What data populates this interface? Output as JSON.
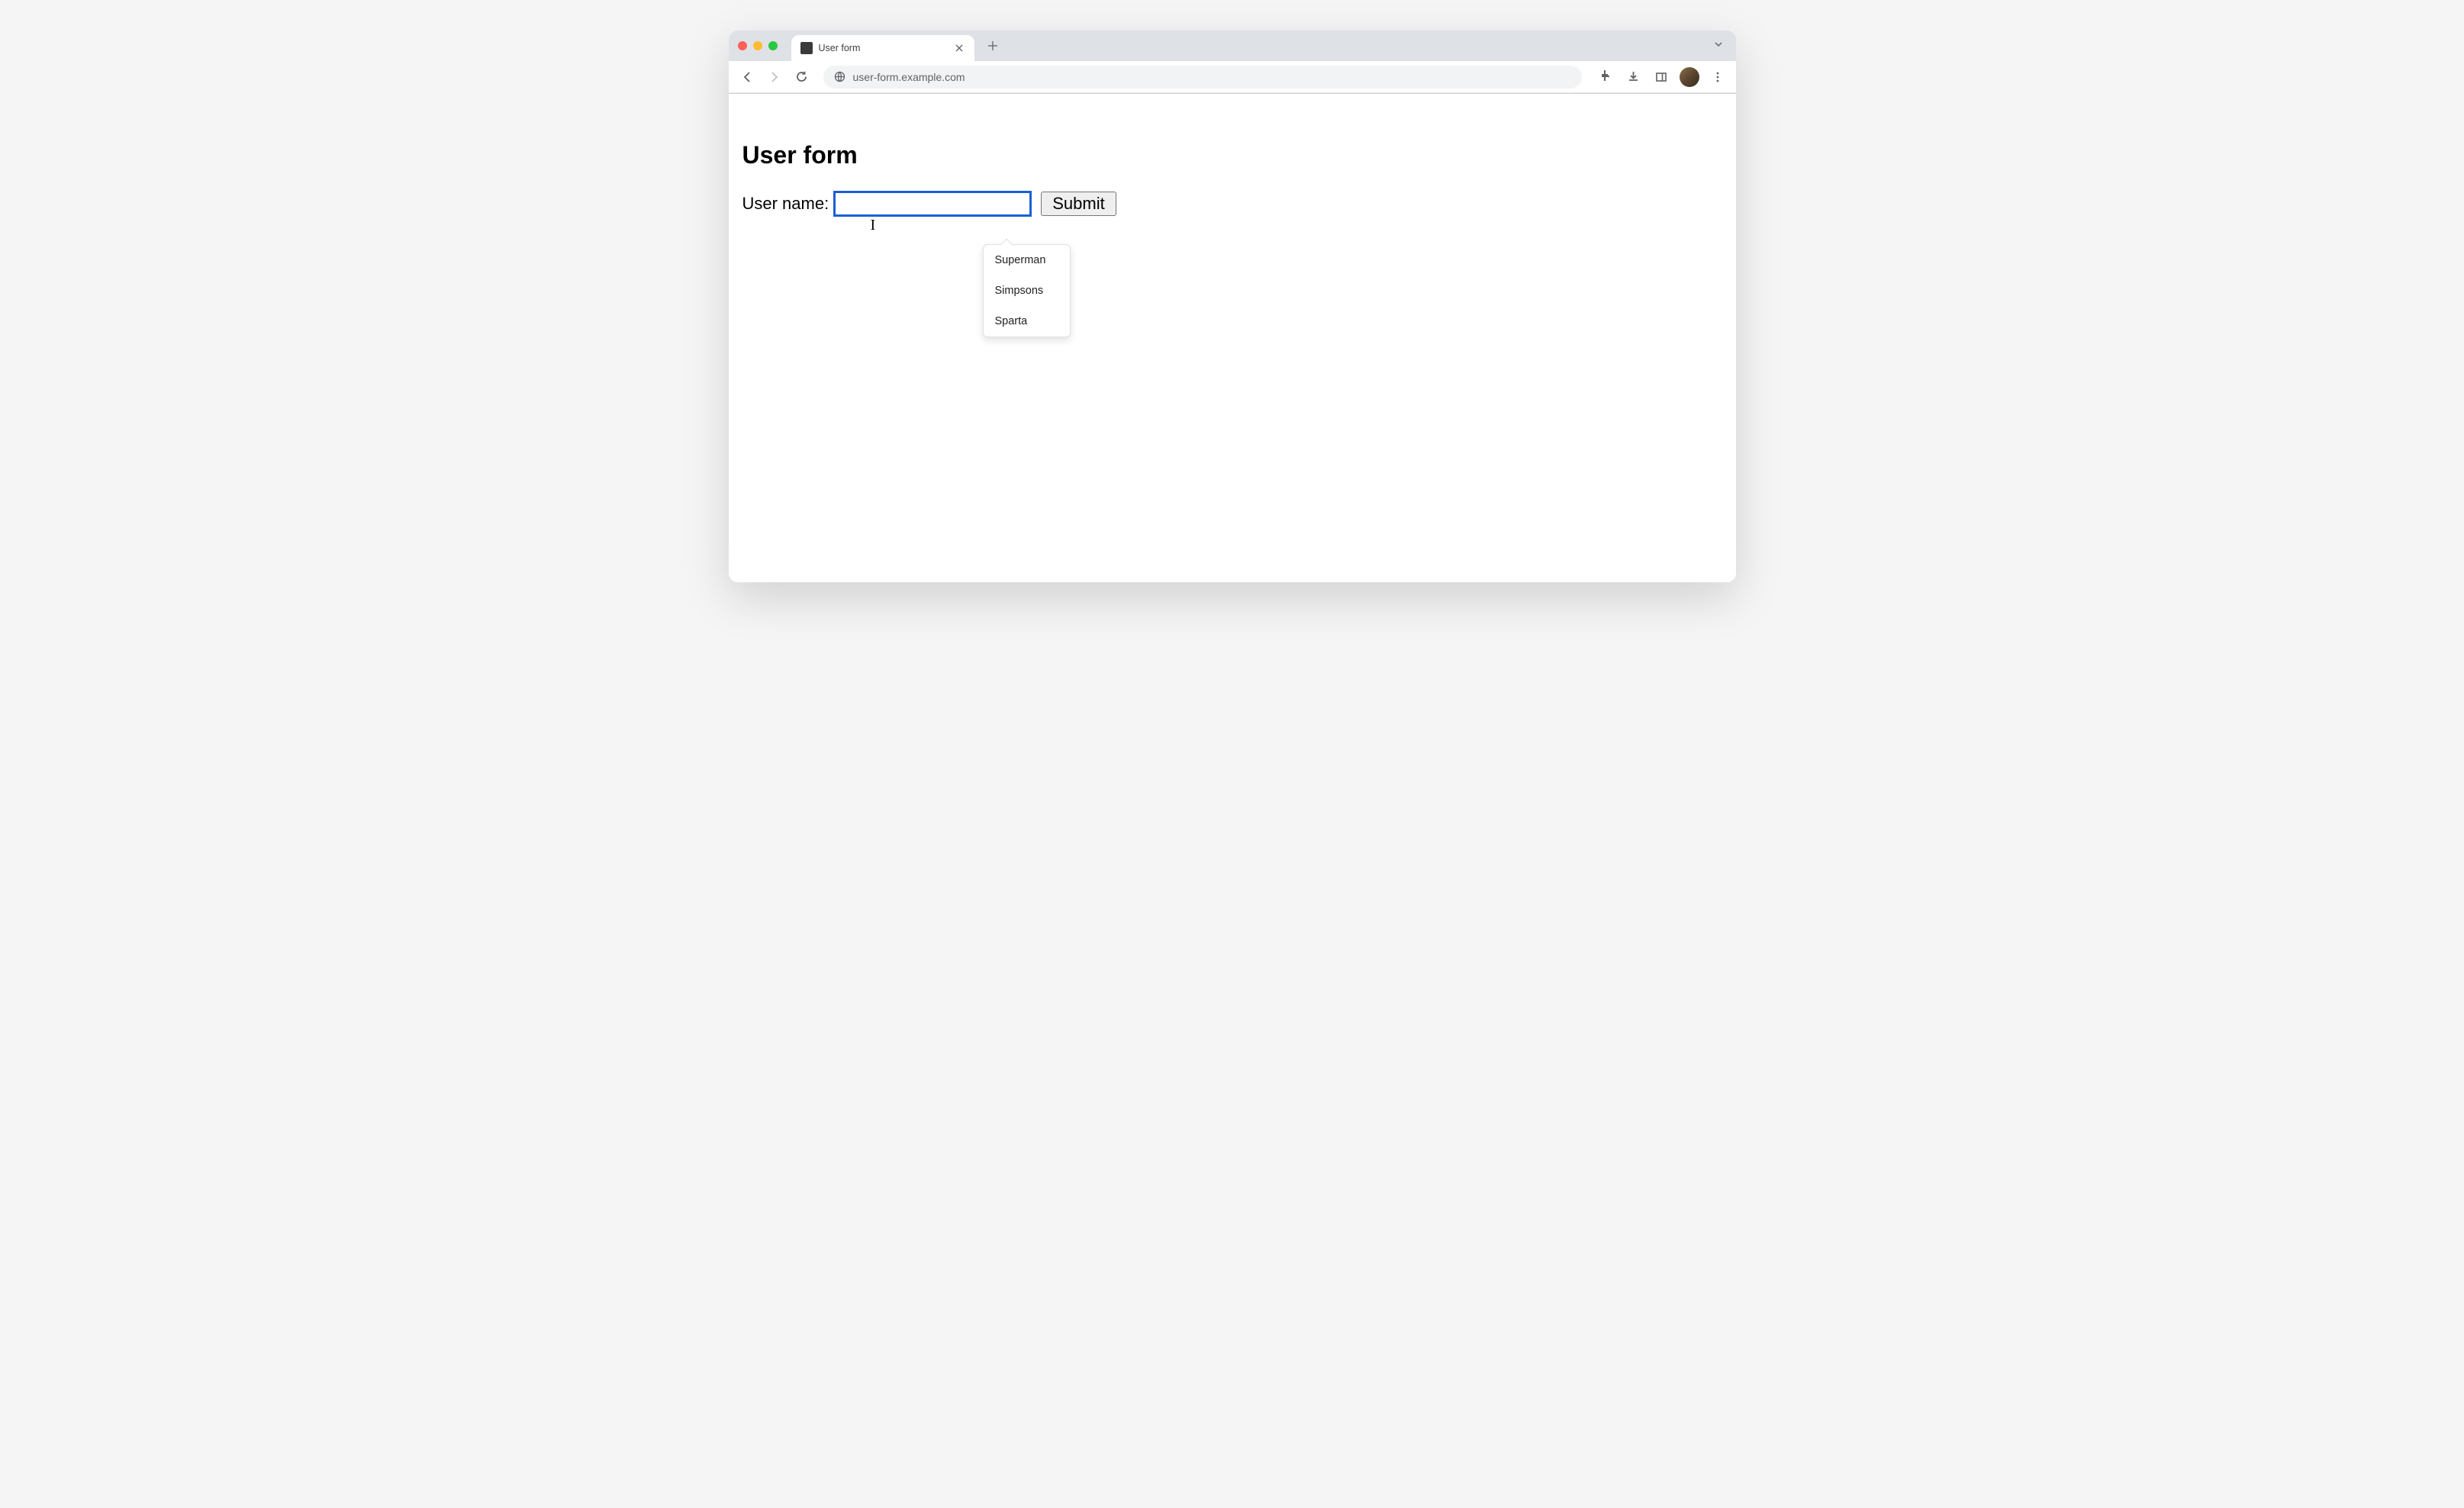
{
  "browser": {
    "tab": {
      "title": "User form"
    },
    "url": "user-form.example.com"
  },
  "page": {
    "heading": "User form",
    "form": {
      "label": "User name:",
      "input_value": "",
      "submit_label": "Submit"
    },
    "autocomplete": {
      "items": [
        "Superman",
        "Simpsons",
        "Sparta"
      ]
    }
  }
}
